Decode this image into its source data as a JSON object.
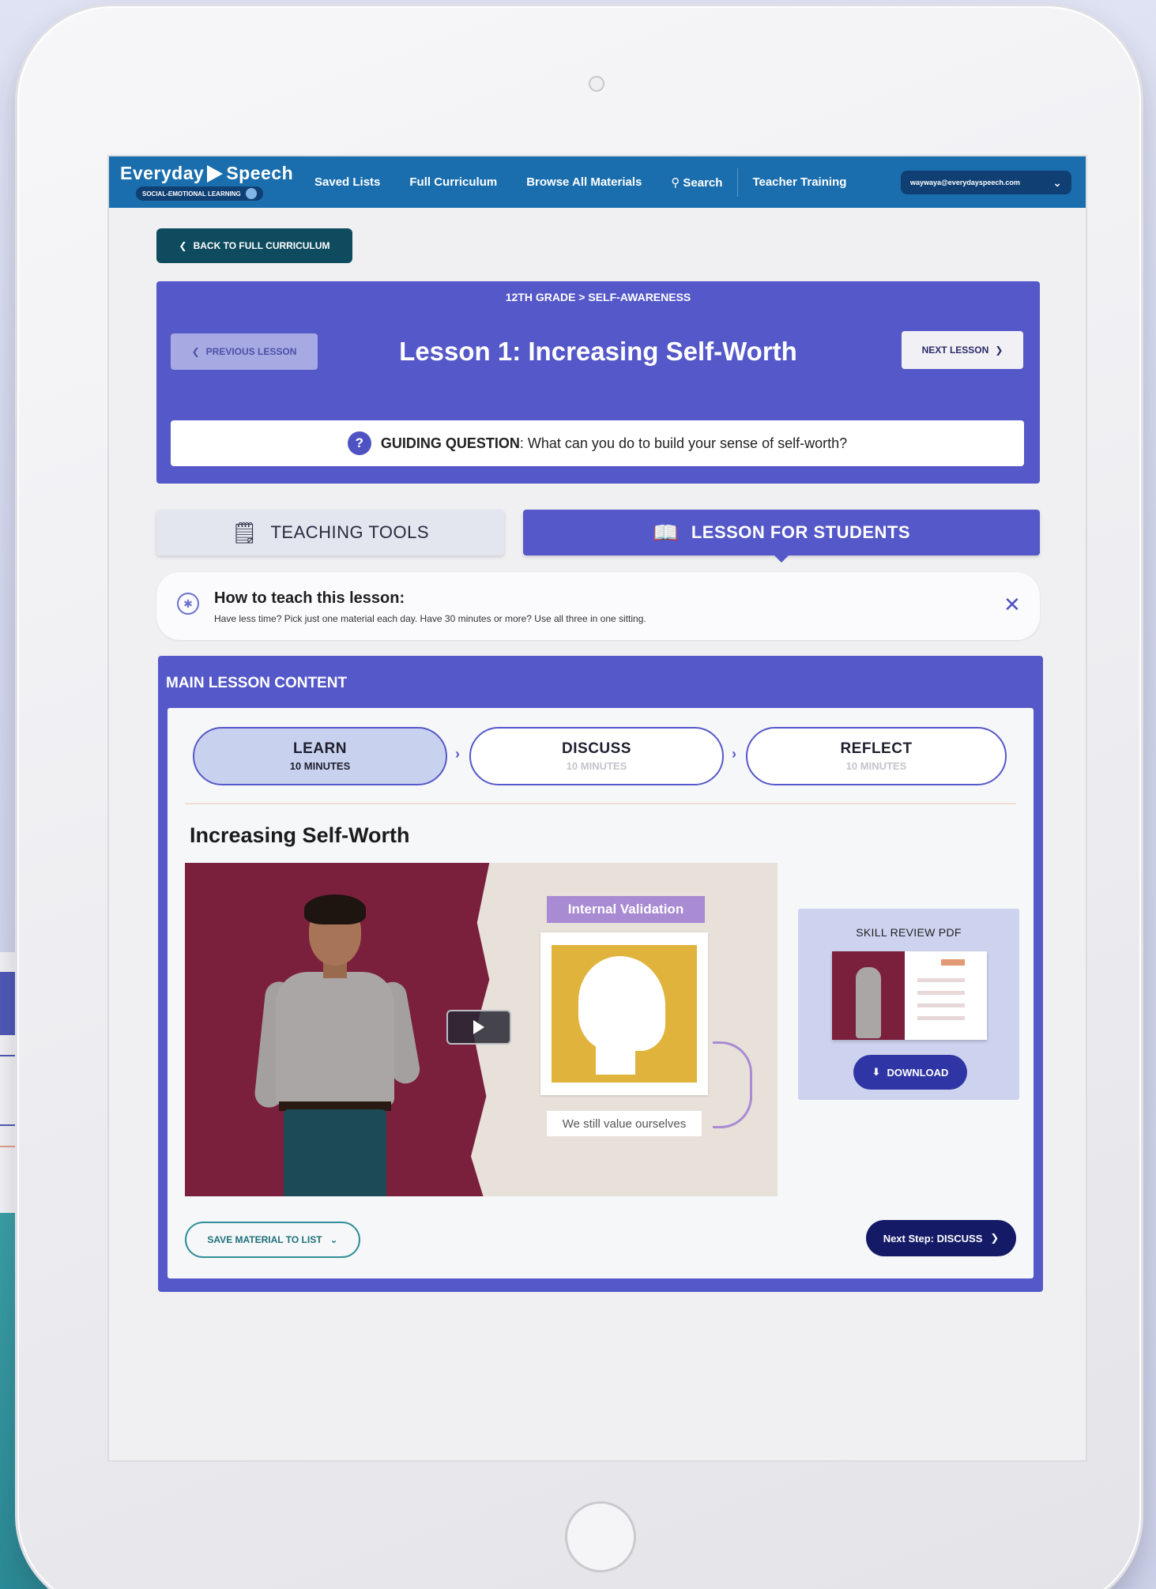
{
  "nav": {
    "logo_main_a": "Everyday",
    "logo_main_b": "Speech",
    "logo_sub": "SOCIAL-EMOTIONAL LEARNING",
    "links": [
      "Saved Lists",
      "Full Curriculum",
      "Browse All Materials",
      "Search",
      "Teacher Training"
    ],
    "account_email": "waywaya@everydayspeech.com"
  },
  "back_button": "BACK TO FULL CURRICULUM",
  "lesson": {
    "breadcrumb": "12TH GRADE > SELF-AWARENESS",
    "title": "Lesson 1: Increasing Self-Worth",
    "prev_label": "PREVIOUS LESSON",
    "next_label": "NEXT LESSON",
    "guiding_label": "GUIDING QUESTION",
    "guiding_text": ": What can you do to build your sense of self-worth?"
  },
  "tabs": {
    "teaching": "TEACHING TOOLS",
    "students": "LESSON FOR STUDENTS"
  },
  "howto": {
    "title": "How to teach this lesson:",
    "text": "Have less time? Pick just one material each day.  Have 30 minutes or more? Use all three in one sitting."
  },
  "main": {
    "title": "MAIN LESSON CONTENT",
    "steps": [
      {
        "name": "LEARN",
        "time": "10 MINUTES"
      },
      {
        "name": "DISCUSS",
        "time": "10 MINUTES"
      },
      {
        "name": "REFLECT",
        "time": "10 MINUTES"
      }
    ],
    "content_title": "Increasing Self-Worth",
    "video": {
      "label": "Internal Validation",
      "caption": "We still value ourselves"
    },
    "skill_review": {
      "title": "SKILL REVIEW PDF",
      "download": "DOWNLOAD"
    },
    "save_label": "SAVE MATERIAL TO LIST",
    "next_step_label": "Next Step: DISCUSS"
  },
  "colors": {
    "nav": "#1a6ead",
    "primary": "#5558c8",
    "dark_navy": "#141a66",
    "teal": "#0e4b5e"
  }
}
